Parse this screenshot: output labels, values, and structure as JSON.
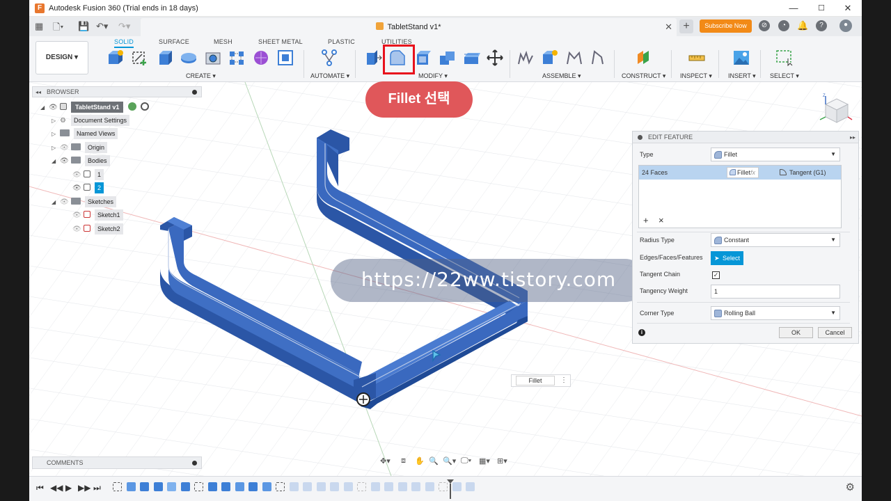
{
  "window": {
    "title": "Autodesk Fusion 360 (Trial ends in 18 days)",
    "min": "—",
    "max": "☐",
    "close": "✕"
  },
  "document_tab": {
    "title": "TabletStand v1*",
    "close": "✕"
  },
  "subscribe_label": "Subscribe Now",
  "design_label": "DESIGN ▾",
  "workspace_tabs": [
    "SOLID",
    "SURFACE",
    "MESH",
    "SHEET METAL",
    "PLASTIC",
    "UTILITIES"
  ],
  "tool_groups": {
    "create": "CREATE ▾",
    "automate": "AUTOMATE ▾",
    "modify": "MODIFY ▾",
    "assemble": "ASSEMBLE ▾",
    "construct": "CONSTRUCT ▾",
    "inspect": "INSPECT ▾",
    "insert": "INSERT ▾",
    "select": "SELECT ▾"
  },
  "callout": "Fillet 선택",
  "browser": {
    "header": "BROWSER",
    "root": "TabletStand v1",
    "document_settings": "Document Settings",
    "named_views": "Named Views",
    "origin": "Origin",
    "bodies": "Bodies",
    "body1": "1",
    "body2": "2",
    "sketches": "Sketches",
    "sketch1": "Sketch1",
    "sketch2": "Sketch2"
  },
  "comments_label": "COMMENTS",
  "watermark": "https://22ww.tistory.com",
  "mini_toolbar": {
    "label": "Fillet"
  },
  "edit_feature": {
    "header": "EDIT FEATURE",
    "type_label": "Type",
    "type_value": "Fillet",
    "faces_count": "24 Faces",
    "faces_type": "Fillet",
    "fx": "fx",
    "faces_continuity": "Tangent (G1)",
    "add": "+",
    "remove": "×",
    "radius_type_label": "Radius Type",
    "radius_type_value": "Constant",
    "edges_label": "Edges/Faces/Features",
    "select_button": "Select",
    "tangent_chain_label": "Tangent Chain",
    "tangent_chain_checked": true,
    "tangency_weight_label": "Tangency Weight",
    "tangency_weight_value": "1",
    "corner_type_label": "Corner Type",
    "corner_type_value": "Rolling Ball",
    "ok": "OK",
    "cancel": "Cancel"
  },
  "colors": {
    "accent": "#0696d7",
    "body_blue": "#3566b8",
    "subscribe": "#f28a17",
    "highlight_red": "#e8111c",
    "callout_bg": "#e0575a"
  }
}
